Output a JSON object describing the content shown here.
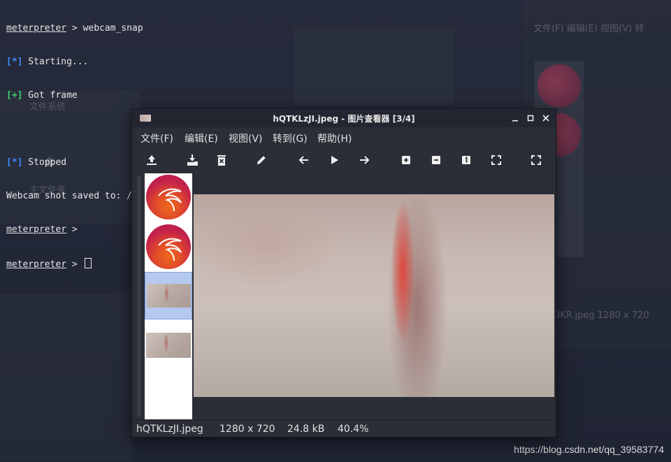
{
  "terminal": {
    "lines": [
      {
        "prompt": "meterpreter",
        "text": " > webcam_snap"
      },
      {
        "tag": "[*]",
        "text": " Starting..."
      },
      {
        "tag": "[+]",
        "text": " Got frame"
      },
      {
        "text": ""
      },
      {
        "tag": "[*]",
        "text": " Stopped"
      },
      {
        "text": "Webcam shot saved to: /root/hQTKLzJI.jpeg"
      },
      {
        "prompt": "meterpreter",
        "text": " >"
      },
      {
        "prompt": "meterpreter",
        "text": " > "
      }
    ],
    "bg_filesystem_label": "文件系统",
    "bg_home_label": "主文件夹"
  },
  "bg_viewer": {
    "menu": "文件(F)   编辑(E)   视图(V)   转",
    "status": "0KR.jpeg    1280 x 720"
  },
  "viewer": {
    "title": "hQTKLzJI.jpeg - 图片查看器 [3/4]",
    "menu": [
      "文件(F)",
      "编辑(E)",
      "视图(V)",
      "转到(G)",
      "帮助(H)"
    ],
    "status": {
      "filename": "hQTKLzJI.jpeg",
      "dimensions": "1280 x 720",
      "size": "24.8 kB",
      "zoom": "40.4%"
    }
  },
  "watermark": "https://blog.csdn.net/qq_39583774"
}
